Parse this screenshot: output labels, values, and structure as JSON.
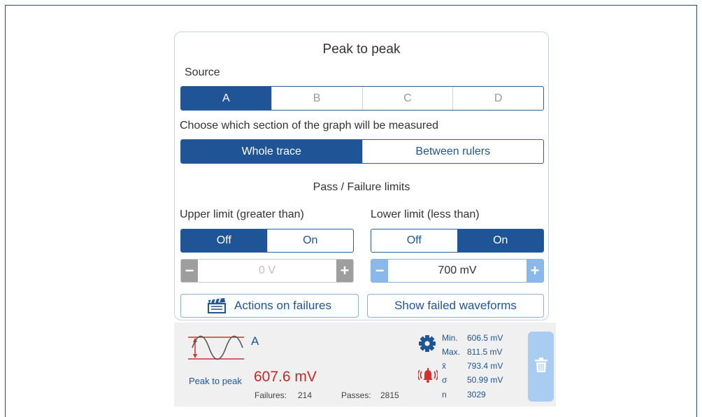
{
  "panel": {
    "title": "Peak to peak",
    "source_label": "Source",
    "sources": [
      "A",
      "B",
      "C",
      "D"
    ],
    "section_label": "Choose which section of the graph will be measured",
    "sections": [
      "Whole trace",
      "Between rulers"
    ],
    "limits_label": "Pass / Failure limits",
    "upper": {
      "label": "Upper limit (greater than)",
      "options": [
        "Off",
        "On"
      ],
      "selected": "Off",
      "minus": "−",
      "plus": "+",
      "value": "0 V"
    },
    "lower": {
      "label": "Lower limit (less than)",
      "options": [
        "Off",
        "On"
      ],
      "selected": "On",
      "minus": "−",
      "plus": "+",
      "value": "700 mV"
    },
    "actions_button": "Actions on failures",
    "show_failed_button": "Show failed waveforms"
  },
  "measurement": {
    "source": "A",
    "name": "Peak to peak",
    "value": "607.6 mV",
    "failures_label": "Failures:",
    "failures": "214",
    "passes_label": "Passes:",
    "passes": "2815",
    "stats": [
      {
        "label": "Min.",
        "value": "606.5 mV"
      },
      {
        "label": "Max.",
        "value": "811.5 mV"
      },
      {
        "label": "x̄",
        "value": "793.4 mV"
      },
      {
        "label": "σ",
        "value": "50.99 mV"
      },
      {
        "label": "n",
        "value": "3029"
      }
    ]
  },
  "colors": {
    "primary": "#1f5597",
    "alarm": "#d32f2f",
    "value": "#c62828",
    "trash": "#a8cdf0"
  }
}
